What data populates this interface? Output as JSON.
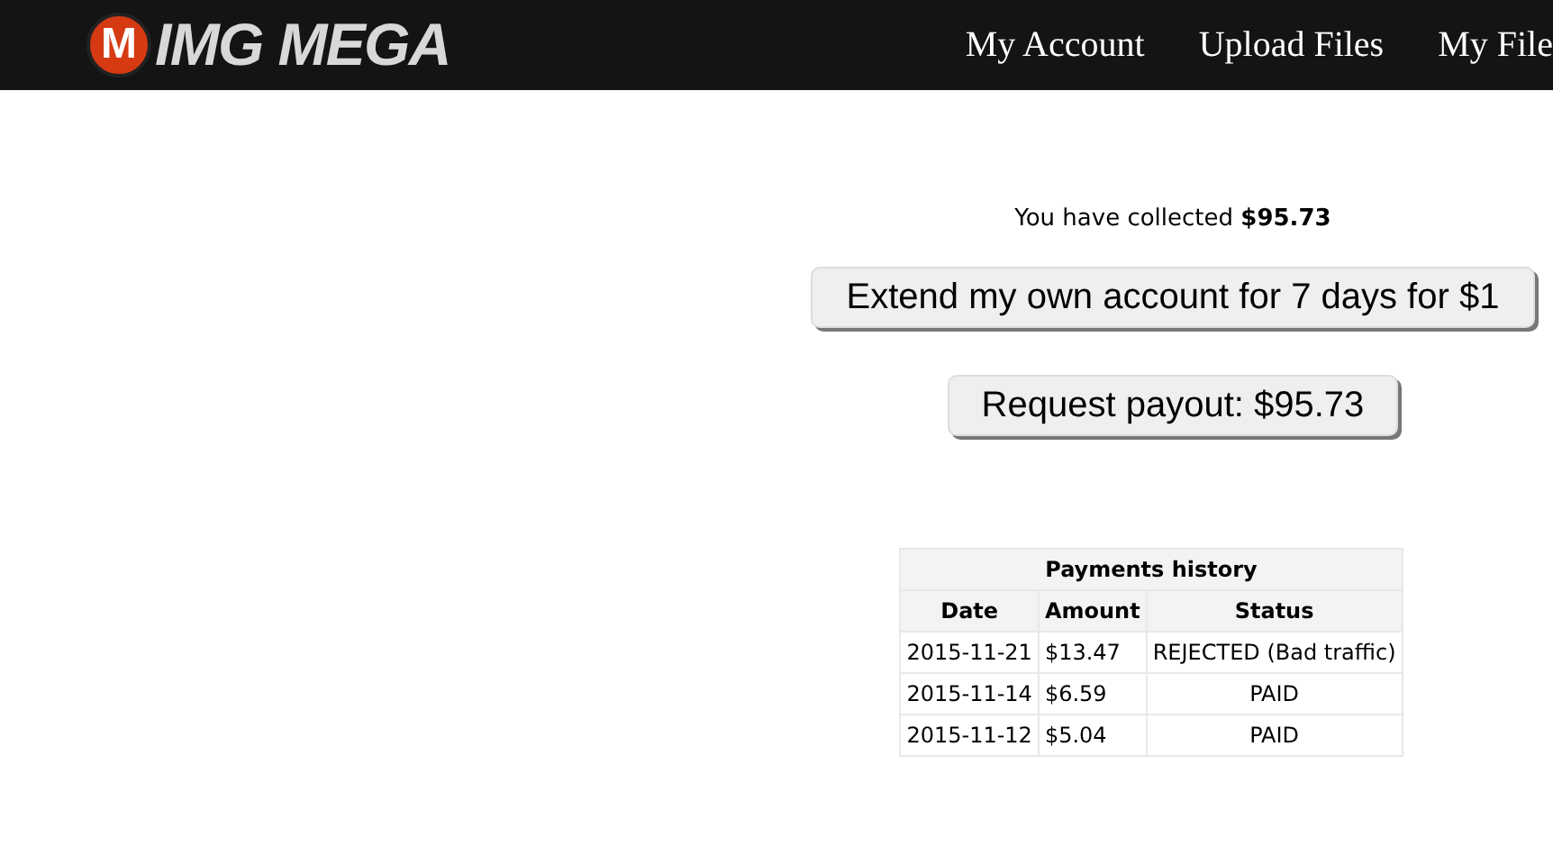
{
  "logo": {
    "mark": "M",
    "text": "IMG MEGA"
  },
  "nav": [
    "My Account",
    "Upload Files",
    "My File"
  ],
  "collected": {
    "label": "You have collected",
    "amount": "$95.73"
  },
  "buttons": [
    "Extend my own account for 7 days for $1",
    "Request payout: $95.73"
  ],
  "table": {
    "title": "Payments history",
    "columns": [
      "Date",
      "Amount",
      "Status"
    ],
    "rows": [
      [
        "2015-11-21",
        "$13.47",
        "REJECTED (Bad traffic)"
      ],
      [
        "2015-11-14",
        "$6.59",
        "PAID"
      ],
      [
        "2015-11-12",
        "$5.04",
        "PAID"
      ]
    ]
  }
}
